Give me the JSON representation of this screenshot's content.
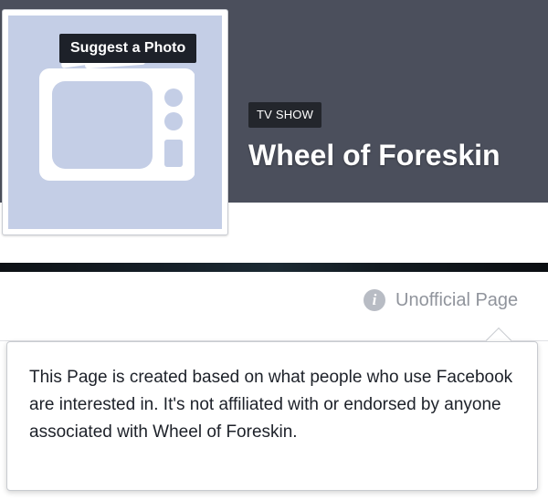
{
  "profile": {
    "suggest_button_label": "Suggest a Photo",
    "picture_icon": "tv-icon"
  },
  "header": {
    "category": "TV SHOW",
    "title": "Wheel of Foreskin"
  },
  "badge": {
    "icon": "info-icon",
    "icon_glyph": "i",
    "label": "Unofficial Page"
  },
  "tooltip": {
    "text": "This Page is created based on what people who use Facebook are interested in. It's not affiliated with or endorsed by anyone associated with Wheel of Foreskin."
  },
  "colors": {
    "cover_background": "#4b4f5c",
    "profile_picture_background": "#c4cee6",
    "badge_background": "#23262c",
    "muted_text": "#90949c"
  }
}
